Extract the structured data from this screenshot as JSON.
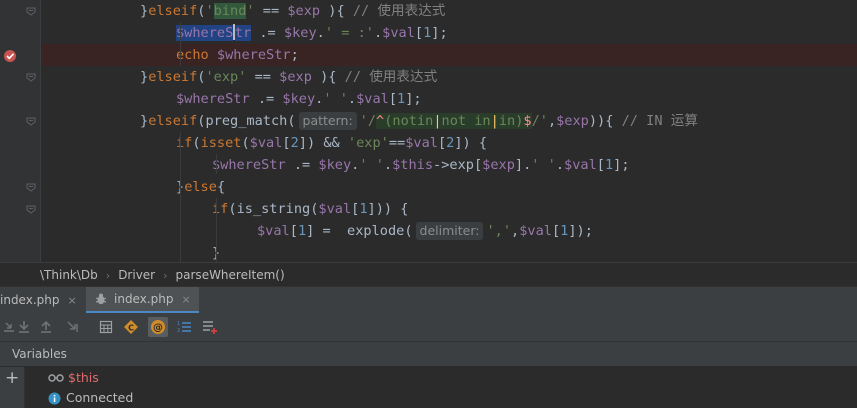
{
  "editor": {
    "lines": [
      {
        "tokens": [
          [
            "}",
            "p"
          ],
          [
            "elseif",
            "kw"
          ],
          [
            "(",
            "p"
          ],
          [
            "'",
            "str"
          ],
          [
            "bind",
            "bind"
          ],
          [
            "'",
            "str"
          ],
          [
            " == ",
            "p"
          ],
          [
            "$exp",
            "var"
          ],
          [
            " ){ ",
            "p"
          ],
          [
            "// 使用表达式",
            "cm"
          ]
        ]
      },
      {
        "tokens": [
          [
            "$whereS",
            "sel"
          ],
          [
            "caret",
            "caret"
          ],
          [
            "tr",
            "sel"
          ],
          [
            " .= ",
            "p"
          ],
          [
            "$key",
            "var"
          ],
          [
            ".",
            "p"
          ],
          [
            "' = :'",
            "str"
          ],
          [
            ".",
            "p"
          ],
          [
            "$val",
            "var"
          ],
          [
            "[",
            "p"
          ],
          [
            "1",
            "num"
          ],
          [
            "];",
            "p"
          ]
        ]
      },
      {
        "tokens": [
          [
            "echo ",
            "kw"
          ],
          [
            "$whereStr",
            "var"
          ],
          [
            ";",
            "p"
          ]
        ]
      },
      {
        "tokens": [
          [
            "}",
            "p"
          ],
          [
            "elseif",
            "kw"
          ],
          [
            "(",
            "p"
          ],
          [
            "'exp'",
            "str"
          ],
          [
            " == ",
            "p"
          ],
          [
            "$exp",
            "var"
          ],
          [
            " ){ ",
            "p"
          ],
          [
            "// 使用表达式",
            "cm"
          ]
        ]
      },
      {
        "tokens": [
          [
            "$whereStr",
            "var"
          ],
          [
            " .= ",
            "p"
          ],
          [
            "$key",
            "var"
          ],
          [
            ".",
            "p"
          ],
          [
            "' '",
            "str"
          ],
          [
            ".",
            "p"
          ],
          [
            "$val",
            "var"
          ],
          [
            "[",
            "p"
          ],
          [
            "1",
            "num"
          ],
          [
            "];",
            "p"
          ]
        ]
      },
      {
        "tokens": [
          [
            "}",
            "p"
          ],
          [
            "elseif",
            "kw"
          ],
          [
            "(",
            "p"
          ],
          [
            "preg_match",
            "p"
          ],
          [
            "(",
            "p"
          ],
          [
            "pattern:",
            "hint"
          ],
          [
            "'/",
            "str"
          ],
          [
            "^",
            "rxa"
          ],
          [
            "(",
            "rxb"
          ],
          [
            "notin",
            "rxb"
          ],
          [
            "|",
            "rxp"
          ],
          [
            "not in",
            "rxb"
          ],
          [
            "|",
            "rxp"
          ],
          [
            "in",
            "rxb"
          ],
          [
            ")",
            "rxb"
          ],
          [
            "$",
            "rxa"
          ],
          [
            "/'",
            "str"
          ],
          [
            ",",
            "p"
          ],
          [
            "$exp",
            "var"
          ],
          [
            ")){ ",
            "p"
          ],
          [
            "// IN 运算",
            "cm"
          ]
        ]
      },
      {
        "tokens": [
          [
            "if",
            "kw"
          ],
          [
            "(",
            "p"
          ],
          [
            "isset",
            "kw"
          ],
          [
            "(",
            "p"
          ],
          [
            "$val",
            "var"
          ],
          [
            "[",
            "p"
          ],
          [
            "2",
            "num"
          ],
          [
            "]) && ",
            "p"
          ],
          [
            "'exp'",
            "str"
          ],
          [
            "==",
            "p"
          ],
          [
            "$val",
            "var"
          ],
          [
            "[",
            "p"
          ],
          [
            "2",
            "num"
          ],
          [
            "]) {",
            "p"
          ]
        ]
      },
      {
        "tokens": [
          [
            "$whereStr",
            "var"
          ],
          [
            " .= ",
            "p"
          ],
          [
            "$key",
            "var"
          ],
          [
            ".",
            "p"
          ],
          [
            "' '",
            "str"
          ],
          [
            ".",
            "p"
          ],
          [
            "$this",
            "var"
          ],
          [
            "->exp[",
            "p"
          ],
          [
            "$exp",
            "var"
          ],
          [
            "].",
            "p"
          ],
          [
            "' '",
            "str"
          ],
          [
            ".",
            "p"
          ],
          [
            "$val",
            "var"
          ],
          [
            "[",
            "p"
          ],
          [
            "1",
            "num"
          ],
          [
            "];",
            "p"
          ]
        ]
      },
      {
        "tokens": [
          [
            "}",
            "p"
          ],
          [
            "else",
            "kw"
          ],
          [
            "{",
            "p"
          ]
        ]
      },
      {
        "tokens": [
          [
            "if",
            "kw"
          ],
          [
            "(",
            "p"
          ],
          [
            "is_string",
            "p"
          ],
          [
            "(",
            "p"
          ],
          [
            "$val",
            "var"
          ],
          [
            "[",
            "p"
          ],
          [
            "1",
            "num"
          ],
          [
            "])) {",
            "p"
          ]
        ]
      },
      {
        "tokens": [
          [
            "$val",
            "var"
          ],
          [
            "[",
            "p"
          ],
          [
            "1",
            "num"
          ],
          [
            "] =  ",
            "p"
          ],
          [
            "explode",
            "p"
          ],
          [
            "(",
            "p"
          ],
          [
            "delimiter:",
            "hint"
          ],
          [
            "','",
            "str"
          ],
          [
            ",",
            "p"
          ],
          [
            "$val",
            "var"
          ],
          [
            "[",
            "p"
          ],
          [
            "1",
            "num"
          ],
          [
            "]);",
            "p"
          ]
        ]
      },
      {
        "tokens": [
          [
            "}",
            "p"
          ]
        ]
      }
    ]
  },
  "breadcrumb": [
    "\\Think\\Db",
    "Driver",
    "parseWhereItem()"
  ],
  "tabs": [
    {
      "label": "index.php",
      "close": "×",
      "active": false
    },
    {
      "label": "index.php",
      "close": "×",
      "active": true
    }
  ],
  "toolbar": {
    "icons": [
      "step-over-icon",
      "step-into-icon",
      "step-out-icon",
      "run-to-cursor-icon",
      "evaluate-icon",
      "class-icon",
      "at-icon",
      "list-icon",
      "add-watch-icon"
    ]
  },
  "variables": {
    "title": "Variables",
    "add_label": "+",
    "items": [
      {
        "name": "$this",
        "color": "#e06c6c"
      },
      {
        "name": "Connected",
        "color": "#bbbbbb"
      }
    ]
  },
  "colors": {
    "editor_bg": "#2b2b2b",
    "keyword": "#cc7832",
    "string": "#6a8759",
    "variable": "#9876aa",
    "comment": "#808080",
    "number": "#6897bb",
    "selection": "#214283",
    "breakpoint_line": "#3a2323",
    "breakpoint": "#c75450"
  }
}
